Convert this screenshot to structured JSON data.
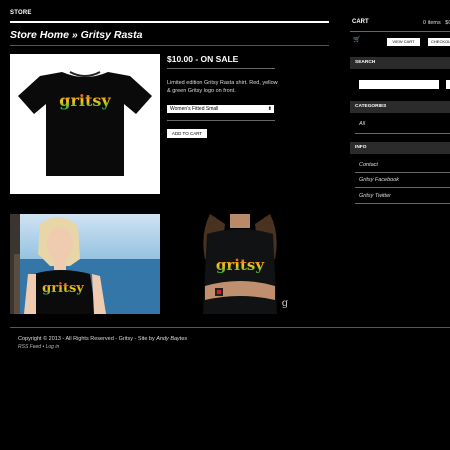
{
  "header": {
    "store_label": "STORE"
  },
  "breadcrumb": "Store Home » Gritsy Rasta",
  "product": {
    "price": "$10.00 - ON SALE",
    "description": "Limited edition Gritsy Rasta shirt. Red, yellow & green Gritsy logo on front.",
    "select_value": "Women's Fitted Small",
    "add_to_cart_label": "ADD TO CART",
    "shirt_logo_text": "gritsy"
  },
  "cart": {
    "title": "CART",
    "items": "0 items",
    "total": "$0",
    "view_cart_label": "VIEW CART",
    "checkout_label": "CHECKOUT"
  },
  "sidebar": {
    "search_heading": "SEARCH",
    "categories_heading": "CATEGORIES",
    "categories": [
      "All"
    ],
    "info_heading": "INFO",
    "info_links": [
      "Contact",
      "Gritsy Facebook",
      "Gritsy Twitter"
    ]
  },
  "footer": {
    "copyright": "Copyright © 2013 - All Rights Reserved - Gritsy - Site by",
    "author": "Andy Baytes",
    "rss": "RSS Feed",
    "separator": "•",
    "login": "Log in"
  },
  "colors": {
    "background": "#000000",
    "logo_red": "#d81e1e",
    "logo_yellow": "#f2c913",
    "logo_green": "#26a83c"
  }
}
